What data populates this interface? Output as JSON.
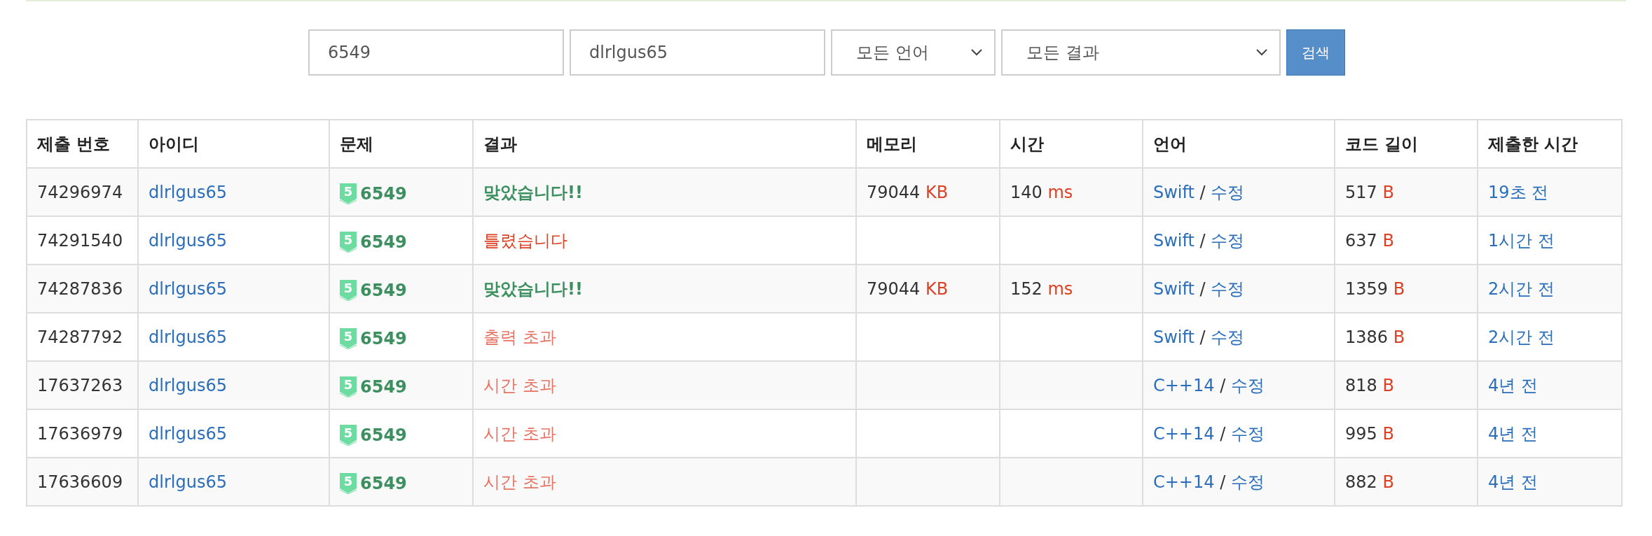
{
  "search": {
    "problem_field": {
      "value": "6549"
    },
    "user_field": {
      "value": "dlrlgus65"
    },
    "language_select": {
      "value": "모든 언어"
    },
    "result_select": {
      "value": "모든 결과"
    },
    "search_button": "검색"
  },
  "table": {
    "columns": [
      "제출 번호",
      "아이디",
      "문제",
      "결과",
      "메모리",
      "시간",
      "언어",
      "코드 길이",
      "제출한 시간"
    ],
    "rows": [
      {
        "id": "74296974",
        "user": "dlrlgus65",
        "tier": "5",
        "problem": "6549",
        "result": {
          "kind": "accepted",
          "text": "맞았습니다!!"
        },
        "memory": {
          "value": "79044",
          "unit": "KB"
        },
        "time": {
          "value": "140",
          "unit": "ms"
        },
        "language": {
          "name": "Swift",
          "separator": "/",
          "edit": "수정"
        },
        "code_length": {
          "value": "517",
          "unit": "B"
        },
        "submitted": "19초 전"
      },
      {
        "id": "74291540",
        "user": "dlrlgus65",
        "tier": "5",
        "problem": "6549",
        "result": {
          "kind": "wrong",
          "text": "틀렸습니다"
        },
        "language": {
          "name": "Swift",
          "separator": "/",
          "edit": "수정"
        },
        "code_length": {
          "value": "637",
          "unit": "B"
        },
        "submitted": "1시간 전"
      },
      {
        "id": "74287836",
        "user": "dlrlgus65",
        "tier": "5",
        "problem": "6549",
        "result": {
          "kind": "accepted",
          "text": "맞았습니다!!"
        },
        "memory": {
          "value": "79044",
          "unit": "KB"
        },
        "time": {
          "value": "152",
          "unit": "ms"
        },
        "language": {
          "name": "Swift",
          "separator": "/",
          "edit": "수정"
        },
        "code_length": {
          "value": "1359",
          "unit": "B"
        },
        "submitted": "2시간 전"
      },
      {
        "id": "74287792",
        "user": "dlrlgus65",
        "tier": "5",
        "problem": "6549",
        "result": {
          "kind": "exceeded",
          "text": "출력 초과"
        },
        "language": {
          "name": "Swift",
          "separator": "/",
          "edit": "수정"
        },
        "code_length": {
          "value": "1386",
          "unit": "B"
        },
        "submitted": "2시간 전"
      },
      {
        "id": "17637263",
        "user": "dlrlgus65",
        "tier": "5",
        "problem": "6549",
        "result": {
          "kind": "exceeded",
          "text": "시간 초과"
        },
        "language": {
          "name": "C++14",
          "separator": "/",
          "edit": "수정"
        },
        "code_length": {
          "value": "818",
          "unit": "B"
        },
        "submitted": "4년 전"
      },
      {
        "id": "17636979",
        "user": "dlrlgus65",
        "tier": "5",
        "problem": "6549",
        "result": {
          "kind": "exceeded",
          "text": "시간 초과"
        },
        "language": {
          "name": "C++14",
          "separator": "/",
          "edit": "수정"
        },
        "code_length": {
          "value": "995",
          "unit": "B"
        },
        "submitted": "4년 전"
      },
      {
        "id": "17636609",
        "user": "dlrlgus65",
        "tier": "5",
        "problem": "6549",
        "result": {
          "kind": "exceeded",
          "text": "시간 초과"
        },
        "language": {
          "name": "C++14",
          "separator": "/",
          "edit": "수정"
        },
        "code_length": {
          "value": "882",
          "unit": "B"
        },
        "submitted": "4년 전"
      }
    ]
  }
}
